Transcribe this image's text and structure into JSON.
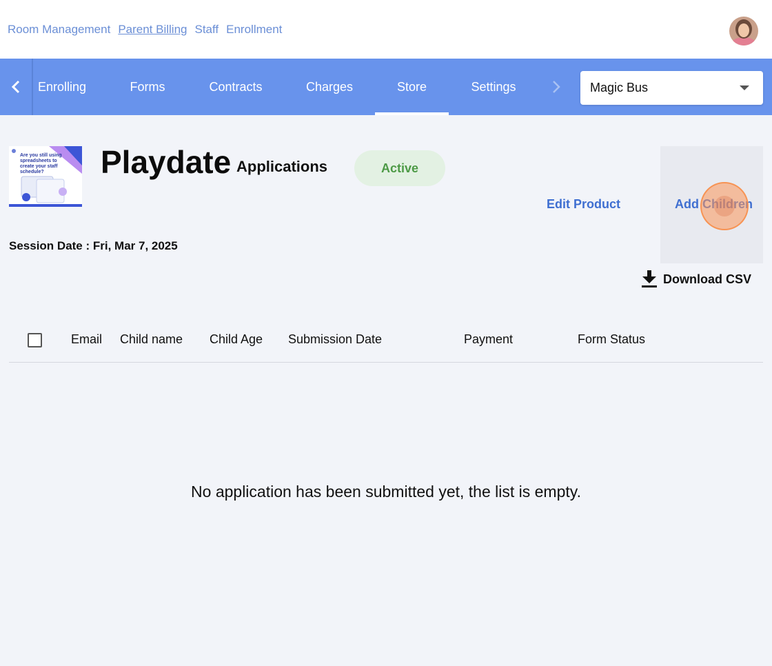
{
  "top_nav": {
    "links": [
      {
        "label": "Room Management"
      },
      {
        "label": "Parent Billing"
      },
      {
        "label": "Staff"
      },
      {
        "label": "Enrollment"
      }
    ]
  },
  "tabs": {
    "items": [
      {
        "label": "Enrolling"
      },
      {
        "label": "Forms"
      },
      {
        "label": "Contracts"
      },
      {
        "label": "Charges"
      },
      {
        "label": "Store"
      },
      {
        "label": "Settings"
      }
    ],
    "active": "Store",
    "org_select": {
      "value": "Magic Bus"
    }
  },
  "product": {
    "thumbnail_text": "Are you still using spreadsheets to create your staff schedule?",
    "title": "Playdate",
    "subtitle": "Applications",
    "status": "Active",
    "edit_label": "Edit Product",
    "add_children_label": "Add Children",
    "session_date": "Session Date : Fri, Mar 7, 2025",
    "download_label": "Download CSV"
  },
  "table": {
    "columns": [
      "Email",
      "Child name",
      "Child Age",
      "Submission Date",
      "Payment",
      "Form Status"
    ],
    "empty_message": "No application has been submitted yet, the list is empty."
  },
  "colors": {
    "tab_bar": "#6893ec",
    "link": "#6b8fd6",
    "accent_action": "#3f6fd1",
    "status_text": "#4d9a46",
    "status_bg": "#e3f1e3"
  }
}
